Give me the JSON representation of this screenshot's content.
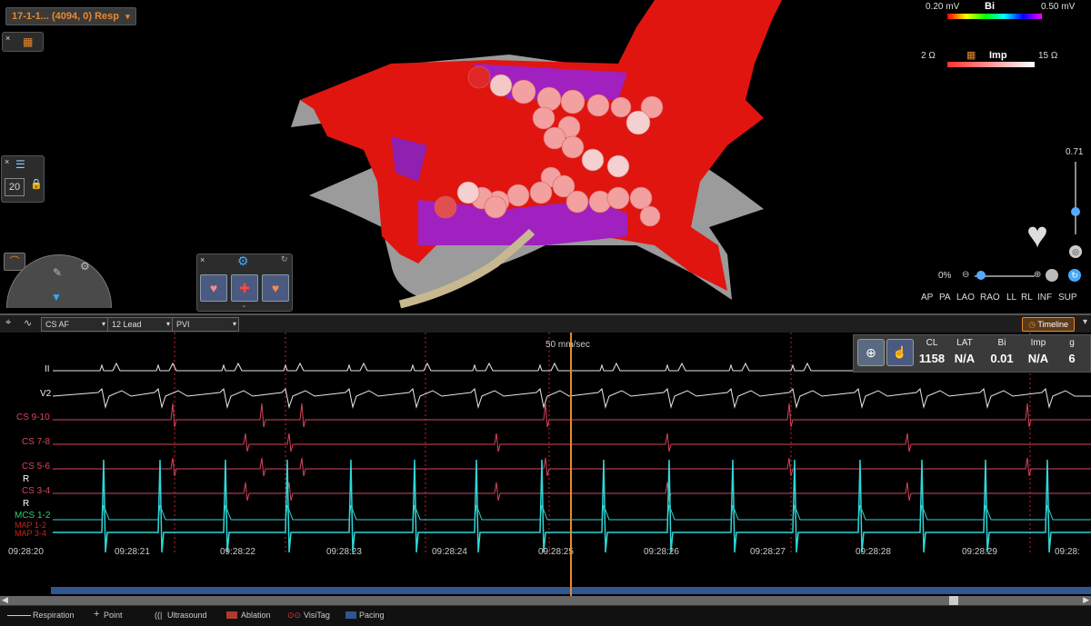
{
  "map": {
    "title": "17-1-1... (4094, 0) Resp"
  },
  "legend_bi": {
    "min": "0.20 mV",
    "name": "Bi",
    "max": "0.50 mV"
  },
  "legend_imp": {
    "min": "2 Ω",
    "name": "Imp",
    "max": "15 Ω"
  },
  "side_panel": {
    "count": "20"
  },
  "zoom": {
    "value": "0.71"
  },
  "transparency": {
    "value": "0%"
  },
  "views": [
    "AP",
    "PA",
    "LAO",
    "RAO",
    "LL",
    "RL",
    "INF",
    "SUP"
  ],
  "toolbar": {
    "select1": "CS AF",
    "select2": "12 Lead",
    "select3": "PVI",
    "timeline": "Timeline"
  },
  "speed": "50 mm/sec",
  "channels": [
    "II",
    "V2",
    "CS 9-10",
    "CS 7-8",
    "CS 5-6",
    "R",
    "CS 3-4",
    "R",
    "MCS 1-2",
    "MAP 1-2",
    "MAP 3-4"
  ],
  "stats": {
    "headers": [
      "CL",
      "LAT",
      "Bi",
      "Imp",
      "g"
    ],
    "values": [
      "1158",
      "N/A",
      "0.01",
      "N/A",
      "6"
    ]
  },
  "times": [
    "09:28:20",
    "09:28:21",
    "09:28:22",
    "09:28:23",
    "09:28:24",
    "09:28:25",
    "09:28:26",
    "09:28:27",
    "09:28:28",
    "09:28:29",
    "09:28:"
  ],
  "status": {
    "respiration": "Respiration",
    "point": "Point",
    "ultrasound": "Ultrasound",
    "ablation": "Ablation",
    "visitag": "VisiTag",
    "pacing": "Pacing"
  },
  "colors": {
    "accent": "#e8892d",
    "ecg_white": "#e8e8e8",
    "cs_red": "#d9445e",
    "map_cyan": "#2fd6d6"
  }
}
